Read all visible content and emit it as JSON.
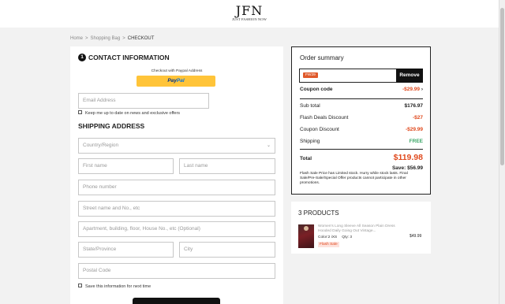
{
  "header": {
    "logo_main": "JFN",
    "logo_sub": "JUST FASHION NOW"
  },
  "breadcrumb": {
    "home": "Home",
    "bag": "Shopping Bag",
    "current": "CHECKOUT"
  },
  "contact": {
    "step": "1",
    "title": "CONTACT INFORMATION",
    "paypal_caption": "Checkout with Paypal Address",
    "paypal_pay": "Pay",
    "paypal_pal": "Pal",
    "email_placeholder": "Email Address",
    "newsletter_label": "Keep me up to date on news and exclusive offers"
  },
  "shipping": {
    "title": "SHIPPING ADDRESS",
    "country_placeholder": "Country/Region",
    "first_name_placeholder": "First name",
    "last_name_placeholder": "Last name",
    "phone_placeholder": "Phone number",
    "street_placeholder": "Street name and No., etc",
    "apartment_placeholder": "Apartment, building, floor, House No., etc (Optional)",
    "state_placeholder": "State/Province",
    "city_placeholder": "City",
    "postal_placeholder": "Postal Code",
    "save_label": "Save this information for next time"
  },
  "summary": {
    "title": "Order summary",
    "coupon_tag": "FW29",
    "remove_label": "Remove",
    "coupon_code_label": "Coupon code",
    "coupon_code_value": "-$29.99",
    "subtotal_label": "Sub total",
    "subtotal_value": "$176.97",
    "flash_label": "Flash Deals Discount",
    "flash_value": "-$27",
    "coupon_discount_label": "Coupon Discount",
    "coupon_discount_value": "-$29.99",
    "shipping_label": "Shipping",
    "shipping_value": "FREE",
    "total_label": "Total",
    "total_value": "$119.98",
    "save_text": "Save: $56.99",
    "note": "Flash Sale Price has Limited stock. Hurry while stock lasts. Final Sale/Pre-Sale/Special Offer products cannot participate in other promotions."
  },
  "products": {
    "title": "3 PRODUCTS",
    "items": [
      {
        "name": "Women's Long Sleeve All Season Plain Dress Hooded Daily Going Out Vintage...",
        "color": "Color:2 iXS",
        "qty": "Qty: 3",
        "badge": "Flash Sale",
        "price": "$49.99"
      }
    ]
  },
  "colors": {
    "accent_red": "#e04a1e",
    "free_green": "#3aa565",
    "paypal_yellow": "#ffc439"
  }
}
